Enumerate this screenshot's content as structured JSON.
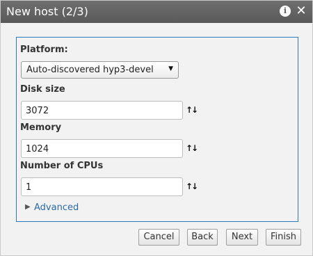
{
  "dialog": {
    "title": "New host (2/3)",
    "title_icons": [
      "info-icon",
      "close-icon"
    ]
  },
  "form": {
    "platform_label": "Platform:",
    "platform_value": "Auto-discovered hyp3-devel",
    "disk_label": "Disk size",
    "disk_value": "3072",
    "memory_label": "Memory",
    "memory_value": "1024",
    "cpus_label": "Number of CPUs",
    "cpus_value": "1",
    "stepper_glyph": "↑↓",
    "advanced_label": "Advanced"
  },
  "buttons": {
    "cancel": "Cancel",
    "back": "Back",
    "next": "Next",
    "finish": "Finish"
  },
  "colors": {
    "titlebar": "#5f5f5f",
    "panel_border": "#2a78b5",
    "link": "#2a6aa8",
    "background": "#f2f2f2"
  }
}
